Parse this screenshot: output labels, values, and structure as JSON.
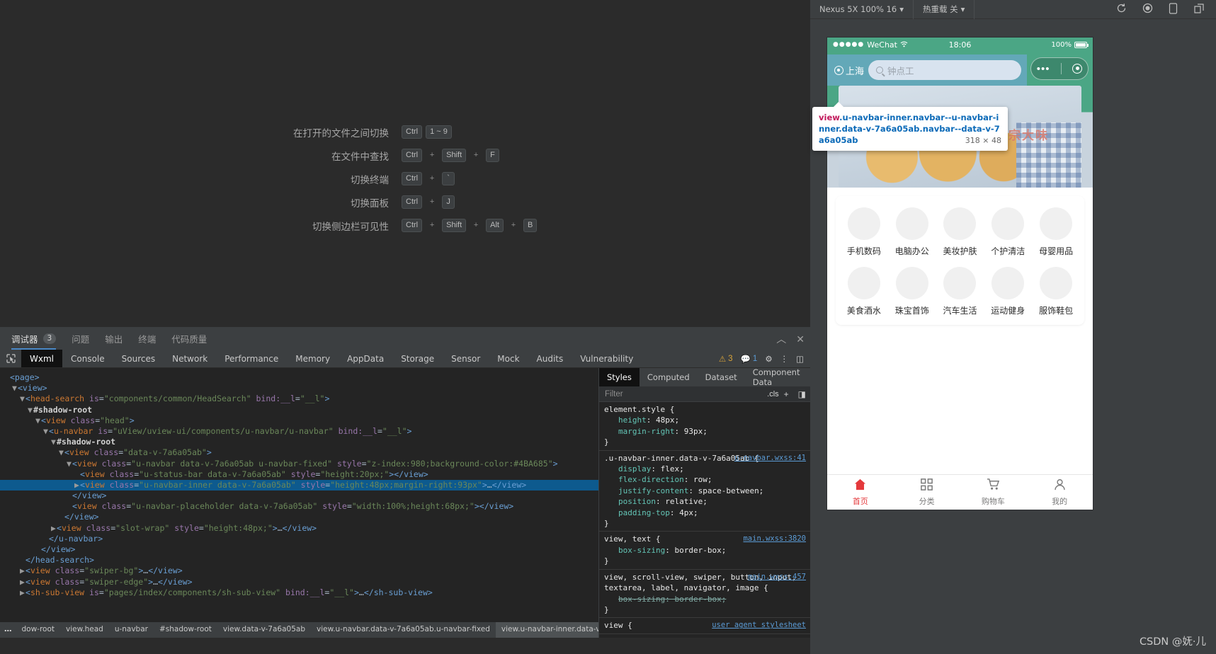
{
  "editor": {
    "shortcuts": [
      {
        "label": "在打开的文件之间切换",
        "keys": [
          "Ctrl",
          "1 ~ 9"
        ]
      },
      {
        "label": "在文件中查找",
        "keys": [
          "Ctrl",
          "+",
          "Shift",
          "+",
          "F"
        ]
      },
      {
        "label": "切换终端",
        "keys": [
          "Ctrl",
          "+",
          "`"
        ]
      },
      {
        "label": "切换面板",
        "keys": [
          "Ctrl",
          "+",
          "J"
        ]
      },
      {
        "label": "切换侧边栏可见性",
        "keys": [
          "Ctrl",
          "+",
          "Shift",
          "+",
          "Alt",
          "+",
          "B"
        ]
      }
    ]
  },
  "panel": {
    "tabs": [
      {
        "label": "调试器",
        "count": "3",
        "active": true
      },
      {
        "label": "问题",
        "count": "",
        "active": false
      },
      {
        "label": "输出",
        "count": "",
        "active": false
      },
      {
        "label": "终端",
        "count": "",
        "active": false
      },
      {
        "label": "代码质量",
        "count": "",
        "active": false
      }
    ],
    "tools": {
      "collapse": "chevron-up-icon",
      "close": "close-icon"
    }
  },
  "devtools": {
    "tabs": [
      "Wxml",
      "Console",
      "Sources",
      "Network",
      "Performance",
      "Memory",
      "AppData",
      "Storage",
      "Sensor",
      "Mock",
      "Audits",
      "Vulnerability"
    ],
    "active_tab": "Wxml",
    "warn_count": "3",
    "info_count": "1",
    "settings_icon": "gear-icon",
    "menu_icon": "kebab-menu-icon",
    "dock_icon": "dock-panel-icon",
    "picker_icon": "element-picker-icon"
  },
  "dom": {
    "lines": [
      {
        "indent": 0,
        "tri": "",
        "html": "<span class='tag'>&lt;page&gt;</span>"
      },
      {
        "indent": 1,
        "tri": "▼",
        "html": "<span class='tag'>&lt;view&gt;</span>"
      },
      {
        "indent": 2,
        "tri": "▼",
        "html": "<span class='tag'>&lt;</span><span class='tagname'>head-search</span> <span class='attr'>is</span>=<span class='val'>\"components/common/HeadSearch\"</span> <span class='attr'>bind:__l</span>=<span class='val'>\"__l\"</span><span class='tag'>&gt;</span>"
      },
      {
        "indent": 3,
        "tri": "▼",
        "html": "<span class='shadow'>#shadow-root</span>"
      },
      {
        "indent": 4,
        "tri": "▼",
        "html": "<span class='tag'>&lt;</span><span class='tagname'>view</span> <span class='attr'>class</span>=<span class='val'>\"head\"</span><span class='tag'>&gt;</span>"
      },
      {
        "indent": 5,
        "tri": "▼",
        "html": "<span class='tag'>&lt;</span><span class='tagname'>u-navbar</span> <span class='attr'>is</span>=<span class='val'>\"uView/uview-ui/components/u-navbar/u-navbar\"</span> <span class='attr'>bind:__l</span>=<span class='val'>\"__l\"</span><span class='tag'>&gt;</span>"
      },
      {
        "indent": 6,
        "tri": "▼",
        "html": "<span class='shadow'>#shadow-root</span>"
      },
      {
        "indent": 7,
        "tri": "▼",
        "html": "<span class='tag'>&lt;</span><span class='tagname'>view</span> <span class='attr'>class</span>=<span class='val'>\"data-v-7a6a05ab\"</span><span class='tag'>&gt;</span>"
      },
      {
        "indent": 8,
        "tri": "▼",
        "html": "<span class='tag'>&lt;</span><span class='tagname'>view</span> <span class='attr'>class</span>=<span class='val'>\"u-navbar data-v-7a6a05ab u-navbar-fixed\"</span> <span class='attr'>style</span>=<span class='val'>\"z-index:980;background-color:#4BA685\"</span><span class='tag'>&gt;</span>"
      },
      {
        "indent": 9,
        "tri": "",
        "html": "<span class='tag'>&lt;</span><span class='tagname'>view</span> <span class='attr'>class</span>=<span class='val'>\"u-status-bar data-v-7a6a05ab\"</span> <span class='attr'>style</span>=<span class='val'>\"height:20px;\"</span><span class='tag'>&gt;&lt;/view&gt;</span>"
      },
      {
        "indent": 9,
        "tri": "▶",
        "sel": true,
        "html": "<span class='tag'>&lt;</span><span class='tagname'>view</span> <span class='attr'>class</span>=<span class='val'>\"u-navbar-inner data-v-7a6a05ab\"</span> <span class='attr'>style</span>=<span class='val'>\"height:48px;margin-right:93px\"</span><span class='tag'>&gt;</span>…<span class='tag'>&lt;/view&gt;</span>"
      },
      {
        "indent": 8,
        "tri": "",
        "html": "<span class='tag'>&lt;/view&gt;</span>"
      },
      {
        "indent": 8,
        "tri": "",
        "html": "<span class='tag'>&lt;</span><span class='tagname'>view</span> <span class='attr'>class</span>=<span class='val'>\"u-navbar-placeholder data-v-7a6a05ab\"</span> <span class='attr'>style</span>=<span class='val'>\"width:100%;height:68px;\"</span><span class='tag'>&gt;&lt;/view&gt;</span>"
      },
      {
        "indent": 7,
        "tri": "",
        "html": "<span class='tag'>&lt;/view&gt;</span>"
      },
      {
        "indent": 6,
        "tri": "▶",
        "html": "<span class='tag'>&lt;</span><span class='tagname'>view</span> <span class='attr'>class</span>=<span class='val'>\"slot-wrap\"</span> <span class='attr'>style</span>=<span class='val'>\"height:48px;\"</span><span class='tag'>&gt;</span>…<span class='tag'>&lt;/view&gt;</span>"
      },
      {
        "indent": 5,
        "tri": "",
        "html": "<span class='tag'>&lt;/u-navbar&gt;</span>"
      },
      {
        "indent": 4,
        "tri": "",
        "html": "<span class='tag'>&lt;/view&gt;</span>"
      },
      {
        "indent": 2,
        "tri": "",
        "html": "<span class='tag'>&lt;/head-search&gt;</span>"
      },
      {
        "indent": 2,
        "tri": "▶",
        "html": "<span class='tag'>&lt;</span><span class='tagname'>view</span> <span class='attr'>class</span>=<span class='val'>\"swiper-bg\"</span><span class='tag'>&gt;</span>…<span class='tag'>&lt;/view&gt;</span>"
      },
      {
        "indent": 2,
        "tri": "▶",
        "html": "<span class='tag'>&lt;</span><span class='tagname'>view</span> <span class='attr'>class</span>=<span class='val'>\"swiper-edge\"</span><span class='tag'>&gt;</span>…<span class='tag'>&lt;/view&gt;</span>"
      },
      {
        "indent": 2,
        "tri": "▶",
        "html": "<span class='tag'>&lt;</span><span class='tagname'>sh-sub-view</span> <span class='attr'>is</span>=<span class='val'>\"pages/index/components/sh-sub-view\"</span> <span class='attr'>bind:__l</span>=<span class='val'>\"__l\"</span><span class='tag'>&gt;</span>…<span class='tag'>&lt;/sh-sub-view&gt;</span>"
      }
    ],
    "breadcrumb": [
      "dow-root",
      "view.head",
      "u-navbar",
      "#shadow-root",
      "view.data-v-7a6a05ab",
      "view.u-navbar.data-v-7a6a05ab.u-navbar-fixed",
      "view.u-navbar-inner.data-v-7a6a05ab"
    ],
    "breadcrumb_overflow": "…",
    "breadcrumb_active": "view.u-navbar-inner.data-v-7a6a05ab"
  },
  "styles": {
    "tabs": [
      "Styles",
      "Computed",
      "Dataset",
      "Component Data"
    ],
    "active_tab": "Styles",
    "more": "»",
    "filter_placeholder": "Filter",
    "cls_label": ".cls",
    "add_label": "+",
    "rules": [
      {
        "selector": "element.style {",
        "source": "",
        "declarations": [
          {
            "prop": "height",
            "value": "48px;",
            "struck": false
          },
          {
            "prop": "margin-right",
            "value": "93px;",
            "struck": false
          }
        ]
      },
      {
        "selector": ".u-navbar-inner.data-v-7a6a05ab {",
        "source": "u-navbar.wxss:41",
        "declarations": [
          {
            "prop": "display",
            "value": "flex;",
            "struck": false
          },
          {
            "prop": "flex-direction",
            "value": "row;",
            "struck": false
          },
          {
            "prop": "justify-content",
            "value": "space-between;",
            "struck": false
          },
          {
            "prop": "position",
            "value": "relative;",
            "struck": false
          },
          {
            "prop": "padding-top",
            "value": "4px;",
            "struck": false
          }
        ]
      },
      {
        "selector": "view, text {",
        "source": "main.wxss:3820",
        "declarations": [
          {
            "prop": "box-sizing",
            "value": "border-box;",
            "struck": false
          }
        ]
      },
      {
        "selector": "view, scroll-view, swiper, button, input, textarea, label, navigator, image {",
        "source": "main.wxss:457",
        "declarations": [
          {
            "prop": "box-sizing",
            "value": "border-box;",
            "struck": true
          }
        ]
      },
      {
        "selector": "view {",
        "source": "user agent stylesheet",
        "declarations": []
      }
    ]
  },
  "simulator": {
    "toolbar": {
      "device": "Nexus 5X 100% 16",
      "hotreload": "热重载 关",
      "icons": [
        "refresh-icon",
        "record-icon",
        "device-icon",
        "detach-icon"
      ]
    },
    "phone": {
      "status_bar": {
        "carrier": "WeChat",
        "signal_dots": "●●●●●",
        "wifi": "wifi-icon",
        "time": "18:06",
        "battery_pct": "100%"
      },
      "navbar": {
        "location": "上海",
        "search_placeholder": "钟点工",
        "more": "•••",
        "target": "target-icon"
      },
      "hero_badge": "宗大味",
      "categories": [
        "手机数码",
        "电脑办公",
        "美妆护肤",
        "个护清洁",
        "母婴用品",
        "美食酒水",
        "珠宝首饰",
        "汽车生活",
        "运动健身",
        "服饰鞋包"
      ],
      "tabbar": [
        {
          "label": "首页",
          "icon": "home-icon",
          "active": true
        },
        {
          "label": "分类",
          "icon": "grid-icon",
          "active": false
        },
        {
          "label": "购物车",
          "icon": "cart-icon",
          "active": false
        },
        {
          "label": "我的",
          "icon": "user-icon",
          "active": false
        }
      ]
    },
    "tooltip": {
      "selector": "view.u-navbar-inner.navbar--u-navbar-inner.data-v-7a6a05ab.navbar--data-v-7a6a05ab",
      "dimensions": "318 × 48"
    }
  },
  "watermark": "CSDN @妩·儿"
}
